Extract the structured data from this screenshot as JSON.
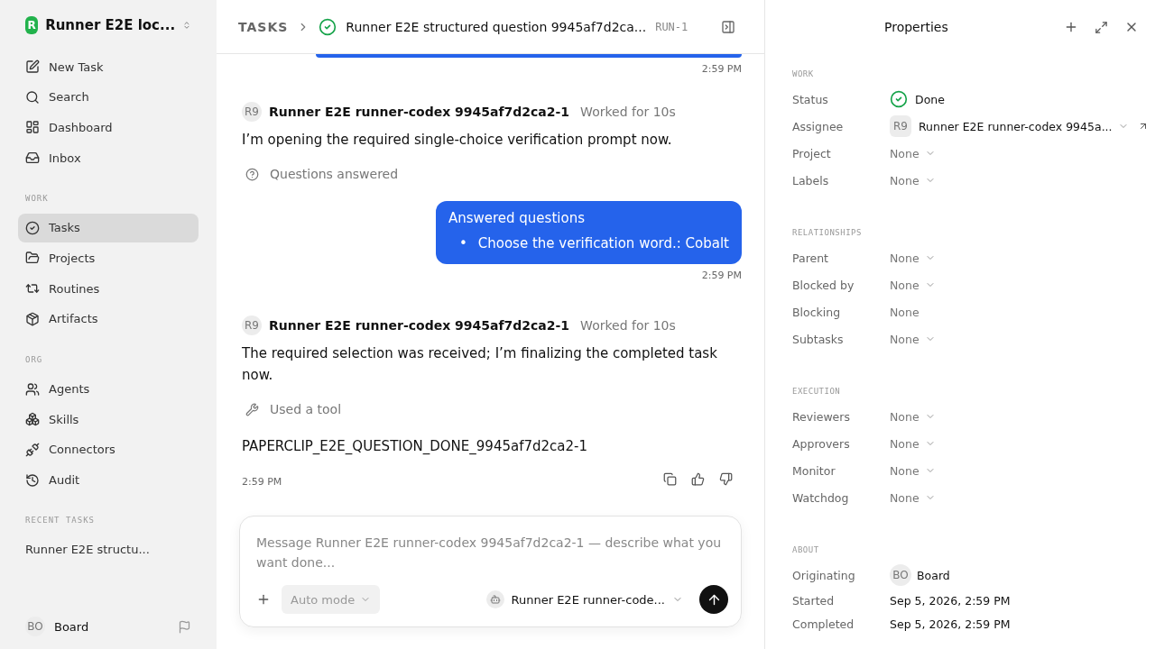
{
  "sidebar": {
    "workspace": {
      "logo": "R",
      "name": "Runner E2E loc..."
    },
    "sections": [
      {
        "items": [
          {
            "label": "New Task",
            "selected": false
          },
          {
            "label": "Search",
            "selected": false
          },
          {
            "label": "Dashboard",
            "selected": false
          },
          {
            "label": "Inbox",
            "selected": false
          }
        ]
      },
      {
        "heading": "WORK",
        "items": [
          {
            "label": "Tasks",
            "selected": true
          },
          {
            "label": "Projects",
            "selected": false
          },
          {
            "label": "Routines",
            "selected": false
          },
          {
            "label": "Artifacts",
            "selected": false
          }
        ]
      },
      {
        "heading": "ORG",
        "items": [
          {
            "label": "Agents",
            "selected": false
          },
          {
            "label": "Skills",
            "selected": false
          },
          {
            "label": "Connectors",
            "selected": false
          },
          {
            "label": "Audit",
            "selected": false
          }
        ]
      }
    ],
    "recent": {
      "heading": "RECENT TASKS",
      "items": [
        "Runner E2E structu..."
      ]
    },
    "user": {
      "initials": "BO",
      "name": "Board"
    }
  },
  "header": {
    "crumb": "TASKS",
    "title": "Runner E2E structured question 9945af7d2ca...",
    "id": "RUN-1"
  },
  "feed": [
    {
      "kind": "user_tail",
      "time": "2:59 PM"
    },
    {
      "kind": "agent",
      "avatar": "R9",
      "author": "Runner E2E runner-codex 9945af7d2ca2-1",
      "meta": "Worked for 10s",
      "text": "I’m opening the required single-choice verification prompt now.",
      "activity": {
        "kind": "question",
        "label": "Questions answered"
      }
    },
    {
      "kind": "user",
      "title": "Answered questions",
      "items": [
        {
          "marker": "•",
          "text": "Choose the verification word.: Cobalt"
        }
      ],
      "time": "2:59 PM"
    },
    {
      "kind": "agent",
      "avatar": "R9",
      "author": "Runner E2E runner-codex 9945af7d2ca2-1",
      "meta": "Worked for 10s",
      "text": "The required selection was received; I’m finalizing the completed task now.",
      "activity": {
        "kind": "tool",
        "label": "Used a tool"
      },
      "output": "PAPERCLIP_E2E_QUESTION_DONE_9945af7d2ca2-1",
      "time": "2:59 PM"
    }
  ],
  "composer": {
    "placeholder": "Message Runner E2E runner-codex 9945af7d2ca2-1 — describe what you want done...",
    "mode": "Auto mode",
    "agent": "Runner E2E runner-code..."
  },
  "properties": {
    "title": "Properties",
    "sections": [
      {
        "heading": "WORK",
        "rows": [
          {
            "kind": "status",
            "label": "Status",
            "value": "Done"
          },
          {
            "kind": "person",
            "label": "Assignee",
            "avatar": "R9",
            "value": "Runner E2E runner-codex 9945a..."
          },
          {
            "kind": "select",
            "label": "Project",
            "value": "None"
          },
          {
            "kind": "select",
            "label": "Labels",
            "value": "None"
          }
        ]
      },
      {
        "heading": "RELATIONSHIPS",
        "rows": [
          {
            "kind": "select",
            "label": "Parent",
            "value": "None"
          },
          {
            "kind": "select",
            "label": "Blocked by",
            "value": "None"
          },
          {
            "kind": "plain",
            "label": "Blocking",
            "value": "None"
          },
          {
            "kind": "select",
            "label": "Subtasks",
            "value": "None"
          }
        ]
      },
      {
        "heading": "EXECUTION",
        "rows": [
          {
            "kind": "select",
            "label": "Reviewers",
            "value": "None"
          },
          {
            "kind": "select",
            "label": "Approvers",
            "value": "None"
          },
          {
            "kind": "select",
            "label": "Monitor",
            "value": "None"
          },
          {
            "kind": "select",
            "label": "Watchdog",
            "value": "None"
          }
        ]
      },
      {
        "heading": "ABOUT",
        "rows": [
          {
            "kind": "origin",
            "label": "Originating",
            "avatar": "BO",
            "value": "Board"
          },
          {
            "kind": "date",
            "label": "Started",
            "value": "Sep 5, 2026, 2:59 PM"
          },
          {
            "kind": "date",
            "label": "Completed",
            "value": "Sep 5, 2026, 2:59 PM"
          }
        ]
      }
    ]
  }
}
